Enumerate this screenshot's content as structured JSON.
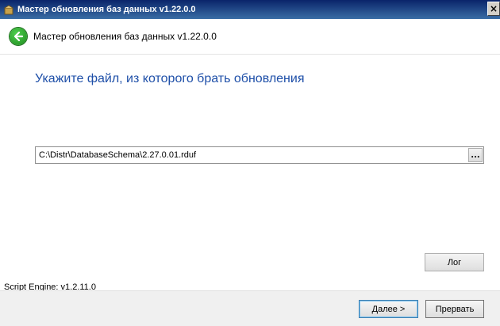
{
  "window": {
    "title": "Мастер обновления баз данных v1.22.0.0",
    "close_glyph": "×",
    "app_icon": "package-icon"
  },
  "header": {
    "back_icon": "back-arrow-icon",
    "title": "Мастер обновления баз данных v1.22.0.0"
  },
  "main": {
    "instruction": "Укажите файл, из которого брать обновления",
    "file_path": "C:\\Distr\\DatabaseSchema\\2.27.0.01.rduf",
    "browse_label": "...",
    "log_button": "Лог",
    "engine_version": "Script Engine: v1.2.11.0"
  },
  "footer": {
    "next_label": "Далее >",
    "cancel_label": "Прервать"
  },
  "colors": {
    "instruction_text": "#1e4fa8",
    "titlebar_start": "#0a246a",
    "titlebar_end": "#3a6ea5",
    "back_button": "#2ea82e"
  }
}
